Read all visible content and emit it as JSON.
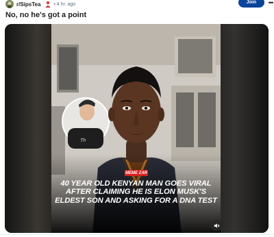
{
  "post": {
    "subreddit": "r/SipsTea",
    "separator": "•",
    "time": "4 hr. ago",
    "join_label": "Join",
    "more_label": "•••",
    "title": "No, no he's got a point"
  },
  "media": {
    "logo_text": "MEME ZAR",
    "headline": "40 YEAR OLD KENYAN MAN GOES VIRAL AFTER CLAIMING HE IS ELON MUSK'S ELDEST SON AND ASKING FOR A DNA TEST",
    "mute_icon": "speaker-muted-icon"
  },
  "colors": {
    "join_bg": "#0a449b",
    "logo_red": "#d81f1f",
    "meta_gray": "#576f76"
  }
}
